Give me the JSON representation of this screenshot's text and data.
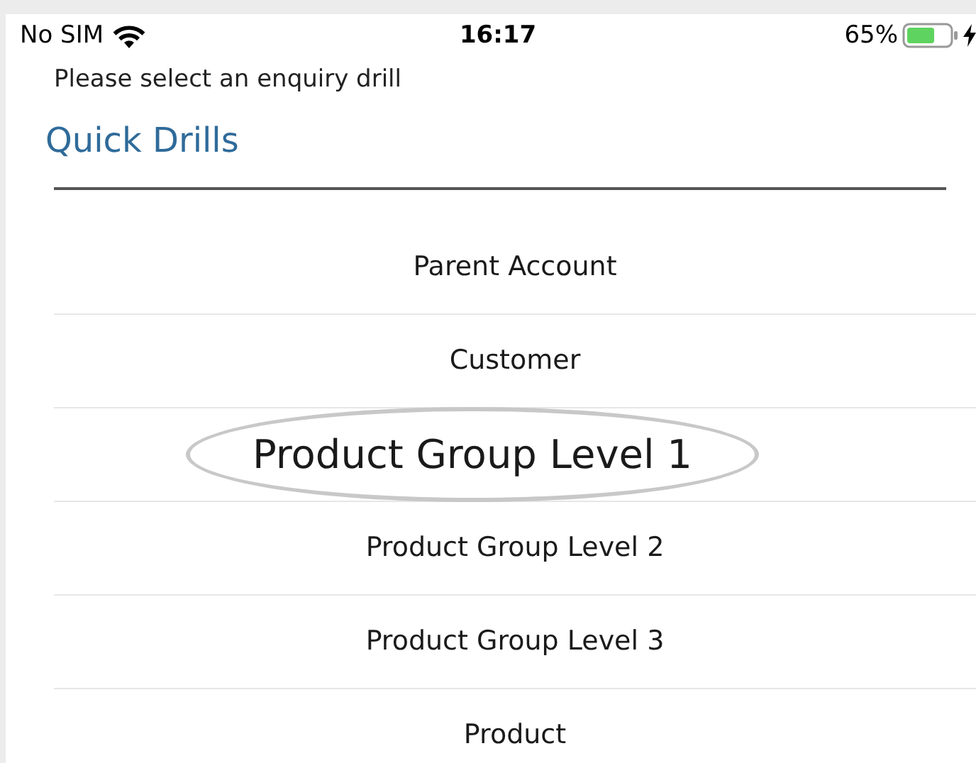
{
  "status_bar": {
    "carrier": "No SIM",
    "time": "16:17",
    "battery": "65%"
  },
  "prompt": "Please select an enquiry drill",
  "section_title": "Quick Drills",
  "drills": [
    {
      "label": "Parent Account",
      "selected": false
    },
    {
      "label": "Customer",
      "selected": false
    },
    {
      "label": "Product Group Level 1",
      "selected": true
    },
    {
      "label": "Product Group Level 2",
      "selected": false
    },
    {
      "label": "Product Group Level 3",
      "selected": false
    },
    {
      "label": "Product",
      "selected": false
    }
  ]
}
